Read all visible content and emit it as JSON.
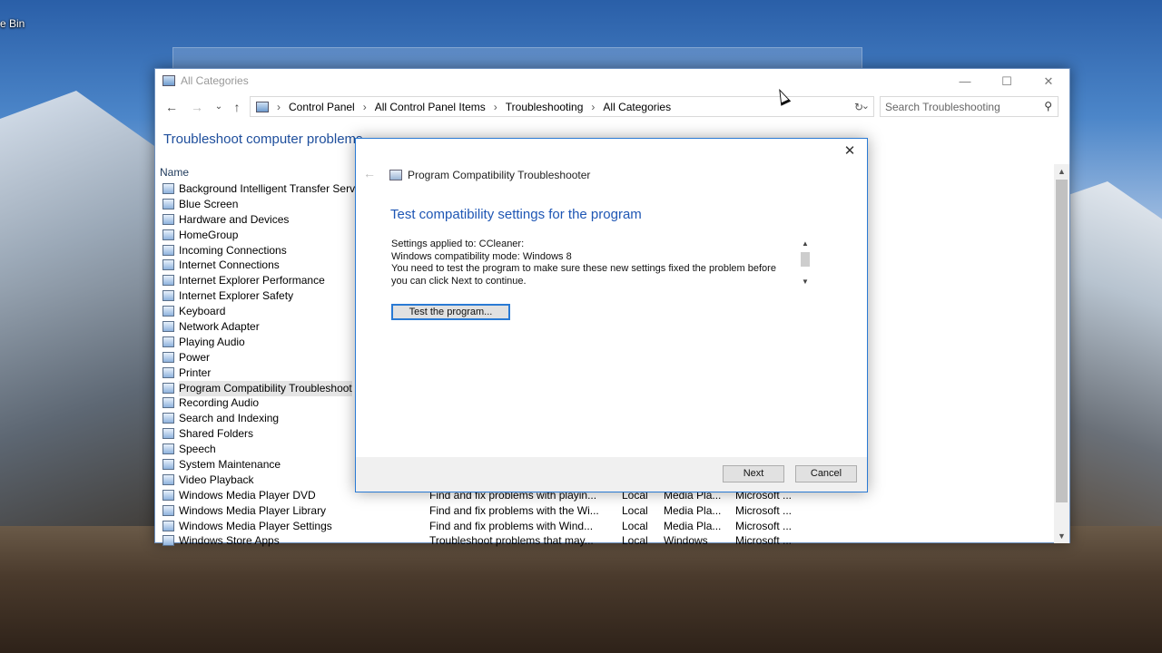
{
  "desktop": {
    "recycle_bin_label": "e Bin"
  },
  "explorer": {
    "title": "All Categories",
    "breadcrumbs": [
      "Control Panel",
      "All Control Panel Items",
      "Troubleshooting",
      "All Categories"
    ],
    "search_placeholder": "Search Troubleshooting",
    "page_title": "Troubleshoot computer problems",
    "column_name": "Name",
    "items": [
      {
        "name": "Background Intelligent Transfer Servic",
        "icon": "transfer-icon"
      },
      {
        "name": "Blue Screen",
        "icon": "windows-logo-icon"
      },
      {
        "name": "Hardware and Devices",
        "icon": "hardware-icon"
      },
      {
        "name": "HomeGroup",
        "icon": "homegroup-icon"
      },
      {
        "name": "Incoming Connections",
        "icon": "network-icon"
      },
      {
        "name": "Internet Connections",
        "icon": "network-icon"
      },
      {
        "name": "Internet Explorer Performance",
        "icon": "internet-explorer-icon"
      },
      {
        "name": "Internet Explorer Safety",
        "icon": "internet-explorer-icon"
      },
      {
        "name": "Keyboard",
        "icon": "keyboard-icon"
      },
      {
        "name": "Network Adapter",
        "icon": "network-adapter-icon"
      },
      {
        "name": "Playing Audio",
        "icon": "audio-icon"
      },
      {
        "name": "Power",
        "icon": "power-icon"
      },
      {
        "name": "Printer",
        "icon": "printer-icon"
      },
      {
        "name": "Program Compatibility Troubleshoot",
        "icon": "program-icon",
        "selected": true
      },
      {
        "name": "Recording Audio",
        "icon": "microphone-icon"
      },
      {
        "name": "Search and Indexing",
        "icon": "search-index-icon"
      },
      {
        "name": "Shared Folders",
        "icon": "folder-icon"
      },
      {
        "name": "Speech",
        "icon": "speech-icon"
      },
      {
        "name": "System Maintenance",
        "icon": "maintenance-icon"
      },
      {
        "name": "Video Playback",
        "icon": "video-icon"
      },
      {
        "name": "Windows Media Player DVD",
        "icon": "media-player-icon",
        "description": "Find and fix problems with playin...",
        "location": "Local",
        "category": "Media Pla...",
        "publisher": "Microsoft ..."
      },
      {
        "name": "Windows Media Player Library",
        "icon": "media-player-icon",
        "description": "Find and fix problems with the Wi...",
        "location": "Local",
        "category": "Media Pla...",
        "publisher": "Microsoft ..."
      },
      {
        "name": "Windows Media Player Settings",
        "icon": "media-player-icon",
        "description": "Find and fix problems with Wind...",
        "location": "Local",
        "category": "Media Pla...",
        "publisher": "Microsoft ..."
      },
      {
        "name": "Windows Store Apps",
        "icon": "store-icon",
        "description": "Troubleshoot problems that may...",
        "location": "Local",
        "category": "Windows",
        "publisher": "Microsoft ..."
      }
    ]
  },
  "dialog": {
    "app_title": "Program Compatibility Troubleshooter",
    "heading": "Test compatibility settings for the program",
    "lines": [
      "Settings applied to: CCleaner:",
      "Windows compatibility mode: Windows 8",
      "You need to test the program to make sure these new settings fixed the problem before you can click Next to continue."
    ],
    "test_button": "Test the program...",
    "next_button": "Next",
    "cancel_button": "Cancel"
  },
  "colors": {
    "accent": "#2a7ad4",
    "heading": "#1e56b4"
  }
}
